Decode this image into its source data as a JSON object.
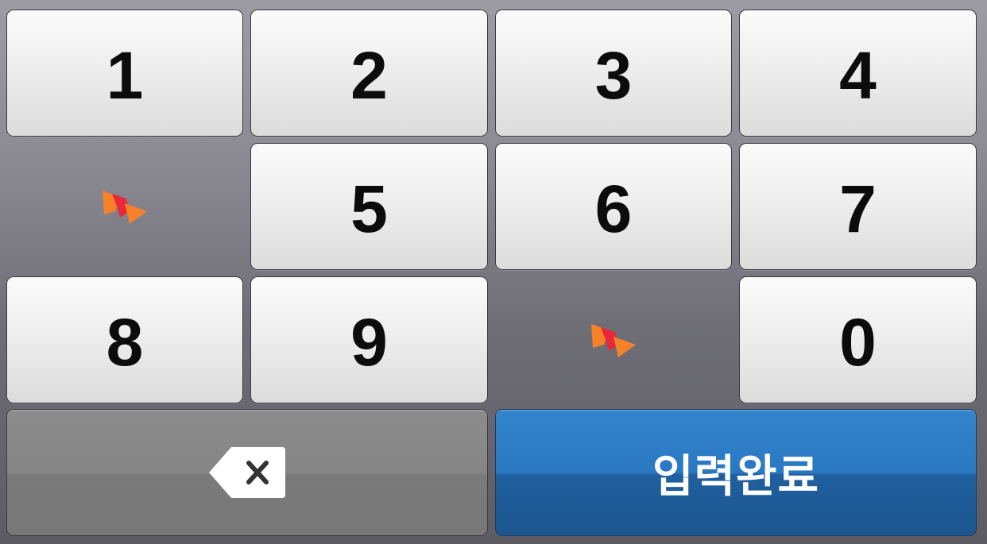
{
  "keypad": {
    "rows": [
      [
        "1",
        "2",
        "3",
        "4"
      ],
      [
        "logo",
        "5",
        "6",
        "7"
      ],
      [
        "8",
        "9",
        "logo",
        "0"
      ]
    ],
    "keys": {
      "k1": "1",
      "k2": "2",
      "k3": "3",
      "k4": "4",
      "k5": "5",
      "k6": "6",
      "k7": "7",
      "k8": "8",
      "k9": "9",
      "k0": "0"
    },
    "backspace_icon": "backspace-icon",
    "logo_icon": "butterfly-logo-icon",
    "done_label": "입력완료"
  },
  "colors": {
    "key_text": "#0c0c0c",
    "done_bg": "#2a78c2",
    "backspace_bg": "#858585",
    "logo_orange": "#f5822a",
    "logo_red": "#e8283a"
  }
}
